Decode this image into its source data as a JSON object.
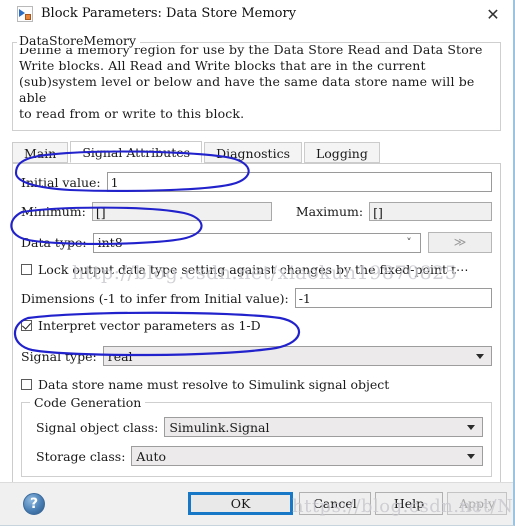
{
  "window": {
    "title": "Block Parameters: Data Store Memory",
    "icon": "simulink-block-icon",
    "close_label": "✕"
  },
  "description": {
    "legend": "DataStoreMemory",
    "text": "Define a memory region for use by the Data Store Read and Data Store\nWrite blocks. All Read and Write blocks that are in the current\n(sub)system level or below and have the same data store name will be able\nto read from or write to this block."
  },
  "tabs": [
    {
      "label": "Main",
      "active": false
    },
    {
      "label": "Signal Attributes",
      "active": true
    },
    {
      "label": "Diagnostics",
      "active": false
    },
    {
      "label": "Logging",
      "active": false
    }
  ],
  "form": {
    "initial_value": {
      "label": "Initial value:",
      "value": "1"
    },
    "minimum": {
      "label": "Minimum:",
      "value": "[]"
    },
    "maximum": {
      "label": "Maximum:",
      "value": "[]"
    },
    "data_type": {
      "label": "Data type:",
      "value": "int8",
      "more_button": "≫"
    },
    "lock_output": {
      "label": "Lock output data type setting against changes by the fixed-point t⋯",
      "checked": false
    },
    "dimensions": {
      "label": "Dimensions (-1 to infer from Initial value):",
      "value": "-1"
    },
    "interpret_vector": {
      "label": "Interpret vector parameters as 1-D",
      "checked": true
    },
    "signal_type": {
      "label": "Signal type:",
      "value": "real"
    },
    "resolve_signal": {
      "label": "Data store name must resolve to Simulink signal object",
      "checked": false
    }
  },
  "code_generation": {
    "legend": "Code Generation",
    "signal_object_class": {
      "label": "Signal object class:",
      "value": "Simulink.Signal"
    },
    "storage_class": {
      "label": "Storage class:",
      "value": "Auto"
    }
  },
  "footer": {
    "help_icon": "?",
    "buttons": [
      {
        "label": "OK",
        "style": "primary",
        "enabled": true
      },
      {
        "label": "Cancel",
        "style": "normal",
        "enabled": true
      },
      {
        "label": "Help",
        "style": "normal",
        "enabled": true
      },
      {
        "label": "Apply",
        "style": "disabled",
        "enabled": false
      }
    ]
  },
  "watermarks": [
    {
      "text": "http://blog.csdn.net/xiaokun19870825"
    },
    {
      "text": "https://blog.csdn.net/Nine_CC"
    }
  ],
  "annotations": {
    "ink_color": "#2222cc",
    "marks": [
      "ellipse-initial-value",
      "ellipse-data-type",
      "ellipse-signal-type"
    ]
  }
}
